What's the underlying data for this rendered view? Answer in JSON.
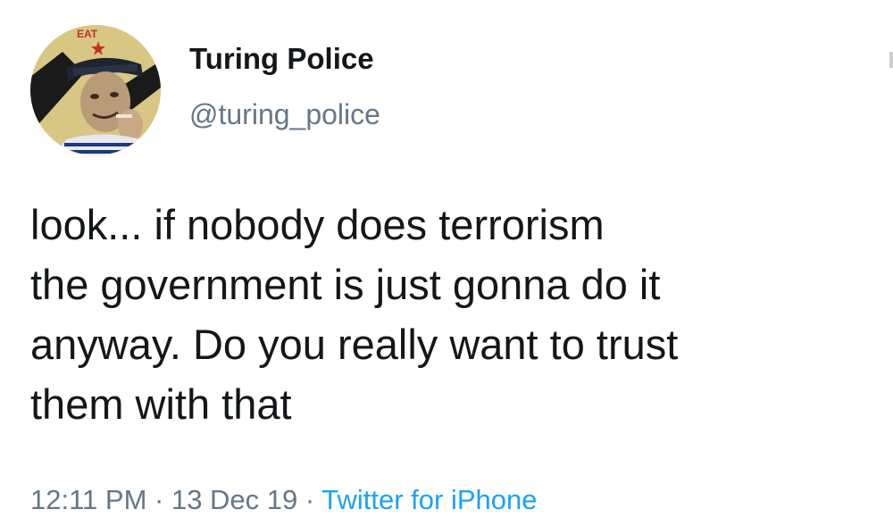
{
  "author": {
    "display_name": "Turing Police",
    "handle": "@turing_police",
    "avatar_text": "EAT",
    "avatar_icon": "sailor-portrait"
  },
  "tweet": {
    "text": "look... if nobody does terrorism\nthe government is just gonna do it\nanyway. Do you really want to trust\nthem with that"
  },
  "meta": {
    "time": "12:11 PM",
    "date": "13 Dec 19",
    "separator": " · ",
    "source": "Twitter for iPhone"
  },
  "colors": {
    "text_primary": "#14171a",
    "text_secondary": "#657786",
    "link": "#1da1f2",
    "background": "#ffffff"
  }
}
